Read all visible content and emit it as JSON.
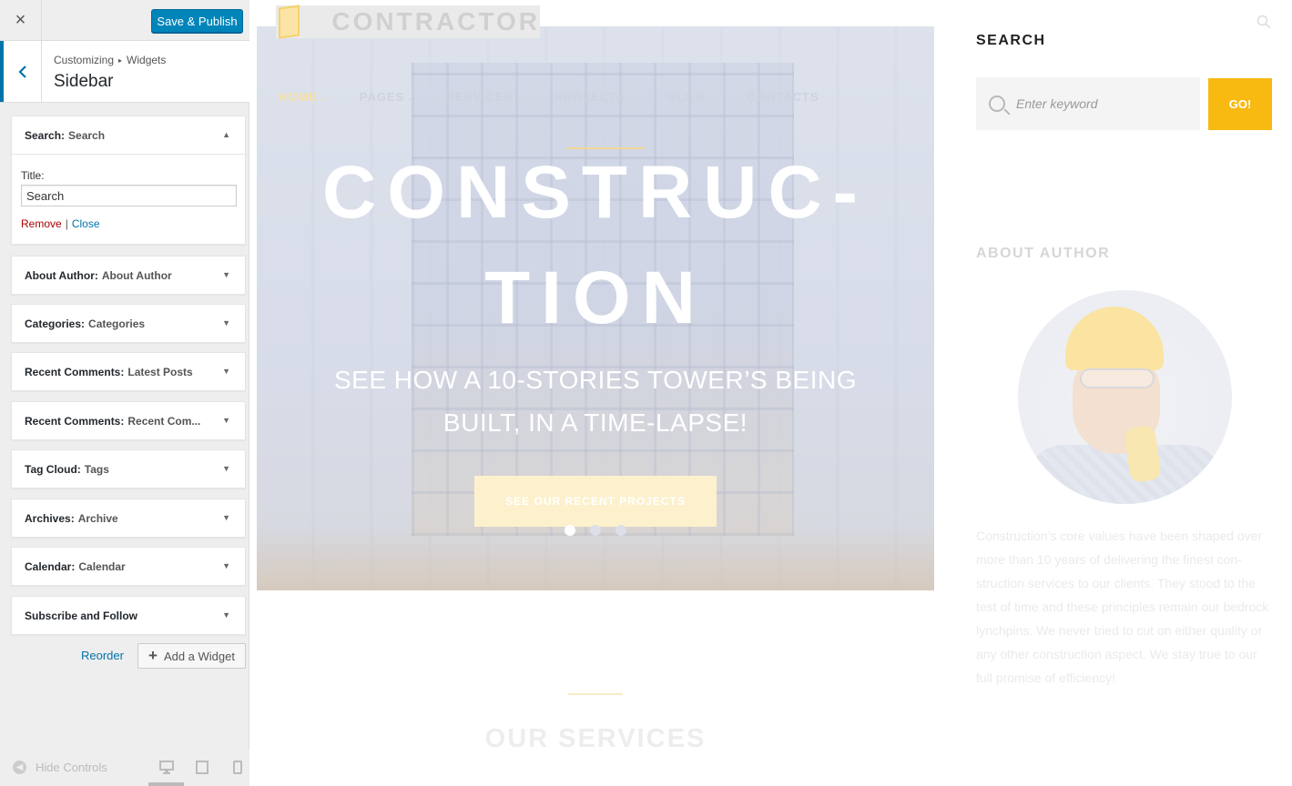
{
  "customizer": {
    "close_glyph": "×",
    "save_button": "Save & Publish",
    "breadcrumb": {
      "part1": "Customizing",
      "sep": "▸",
      "part2": "Widgets"
    },
    "section_title": "Sidebar",
    "widgets": [
      {
        "type": "Search:",
        "title": "Search",
        "expanded": true
      },
      {
        "type": "About Author:",
        "title": "About Author",
        "expanded": false
      },
      {
        "type": "Categories:",
        "title": "Categories",
        "expanded": false
      },
      {
        "type": "Recent Comments:",
        "title": "Latest Posts",
        "expanded": false
      },
      {
        "type": "Recent Comments:",
        "title": "Recent Com...",
        "expanded": false
      },
      {
        "type": "Tag Cloud:",
        "title": "Tags",
        "expanded": false
      },
      {
        "type": "Archives:",
        "title": "Archive",
        "expanded": false
      },
      {
        "type": "Calendar:",
        "title": "Calendar",
        "expanded": false
      },
      {
        "type": "Subscribe and Follow",
        "title": "",
        "expanded": false
      }
    ],
    "search_widget_form": {
      "title_label": "Title:",
      "title_value": "Search",
      "remove_label": "Remove",
      "separator": "|",
      "close_label": "Close"
    },
    "reorder_label": "Reorder",
    "add_widget_label": "Add a Widget",
    "hide_controls_label": "Hide Controls",
    "devices": [
      "desktop-icon",
      "tablet-icon",
      "mobile-icon"
    ],
    "accent_color": "#0073aa",
    "save_color": "#0085ba"
  },
  "preview": {
    "logo_text": "CONTRACTOR",
    "nav": [
      {
        "label": "HOME",
        "active": true
      },
      {
        "label": "PAGES",
        "active": false
      },
      {
        "label": "SERVICES",
        "active": false
      },
      {
        "label": "PROJECTS",
        "active": false
      },
      {
        "label": "BLOG",
        "active": false
      },
      {
        "label": "CONTACTS",
        "active": false
      }
    ],
    "hero": {
      "title_line1": "CONSTRUC-",
      "title_line2": "TION",
      "subtitle_line1": "SEE HOW A 10-STORIES TOWER’S BEING",
      "subtitle_line2": "BUILT, IN A TIME-LAPSE!",
      "button": "SEE OUR RECENT PROJECTS",
      "slides": 3,
      "active_slide": 1
    },
    "services_heading": "OUR SERVICES",
    "sidebar": {
      "search_heading": "SEARCH",
      "search_placeholder": "Enter keyword",
      "go_button": "GO!",
      "about_heading": "ABOUT AUTHOR",
      "about_text": "Construction’s core values have been shaped over more than 10 years of delivering the finest con-struction services to our clients. They stood to the test of time and these principles remain our bedrock lynchpins. We never tried to cut on either quality or any other construction aspect. We stay true to our full promise of efficiency!"
    },
    "accent_color": "#f8b911"
  }
}
